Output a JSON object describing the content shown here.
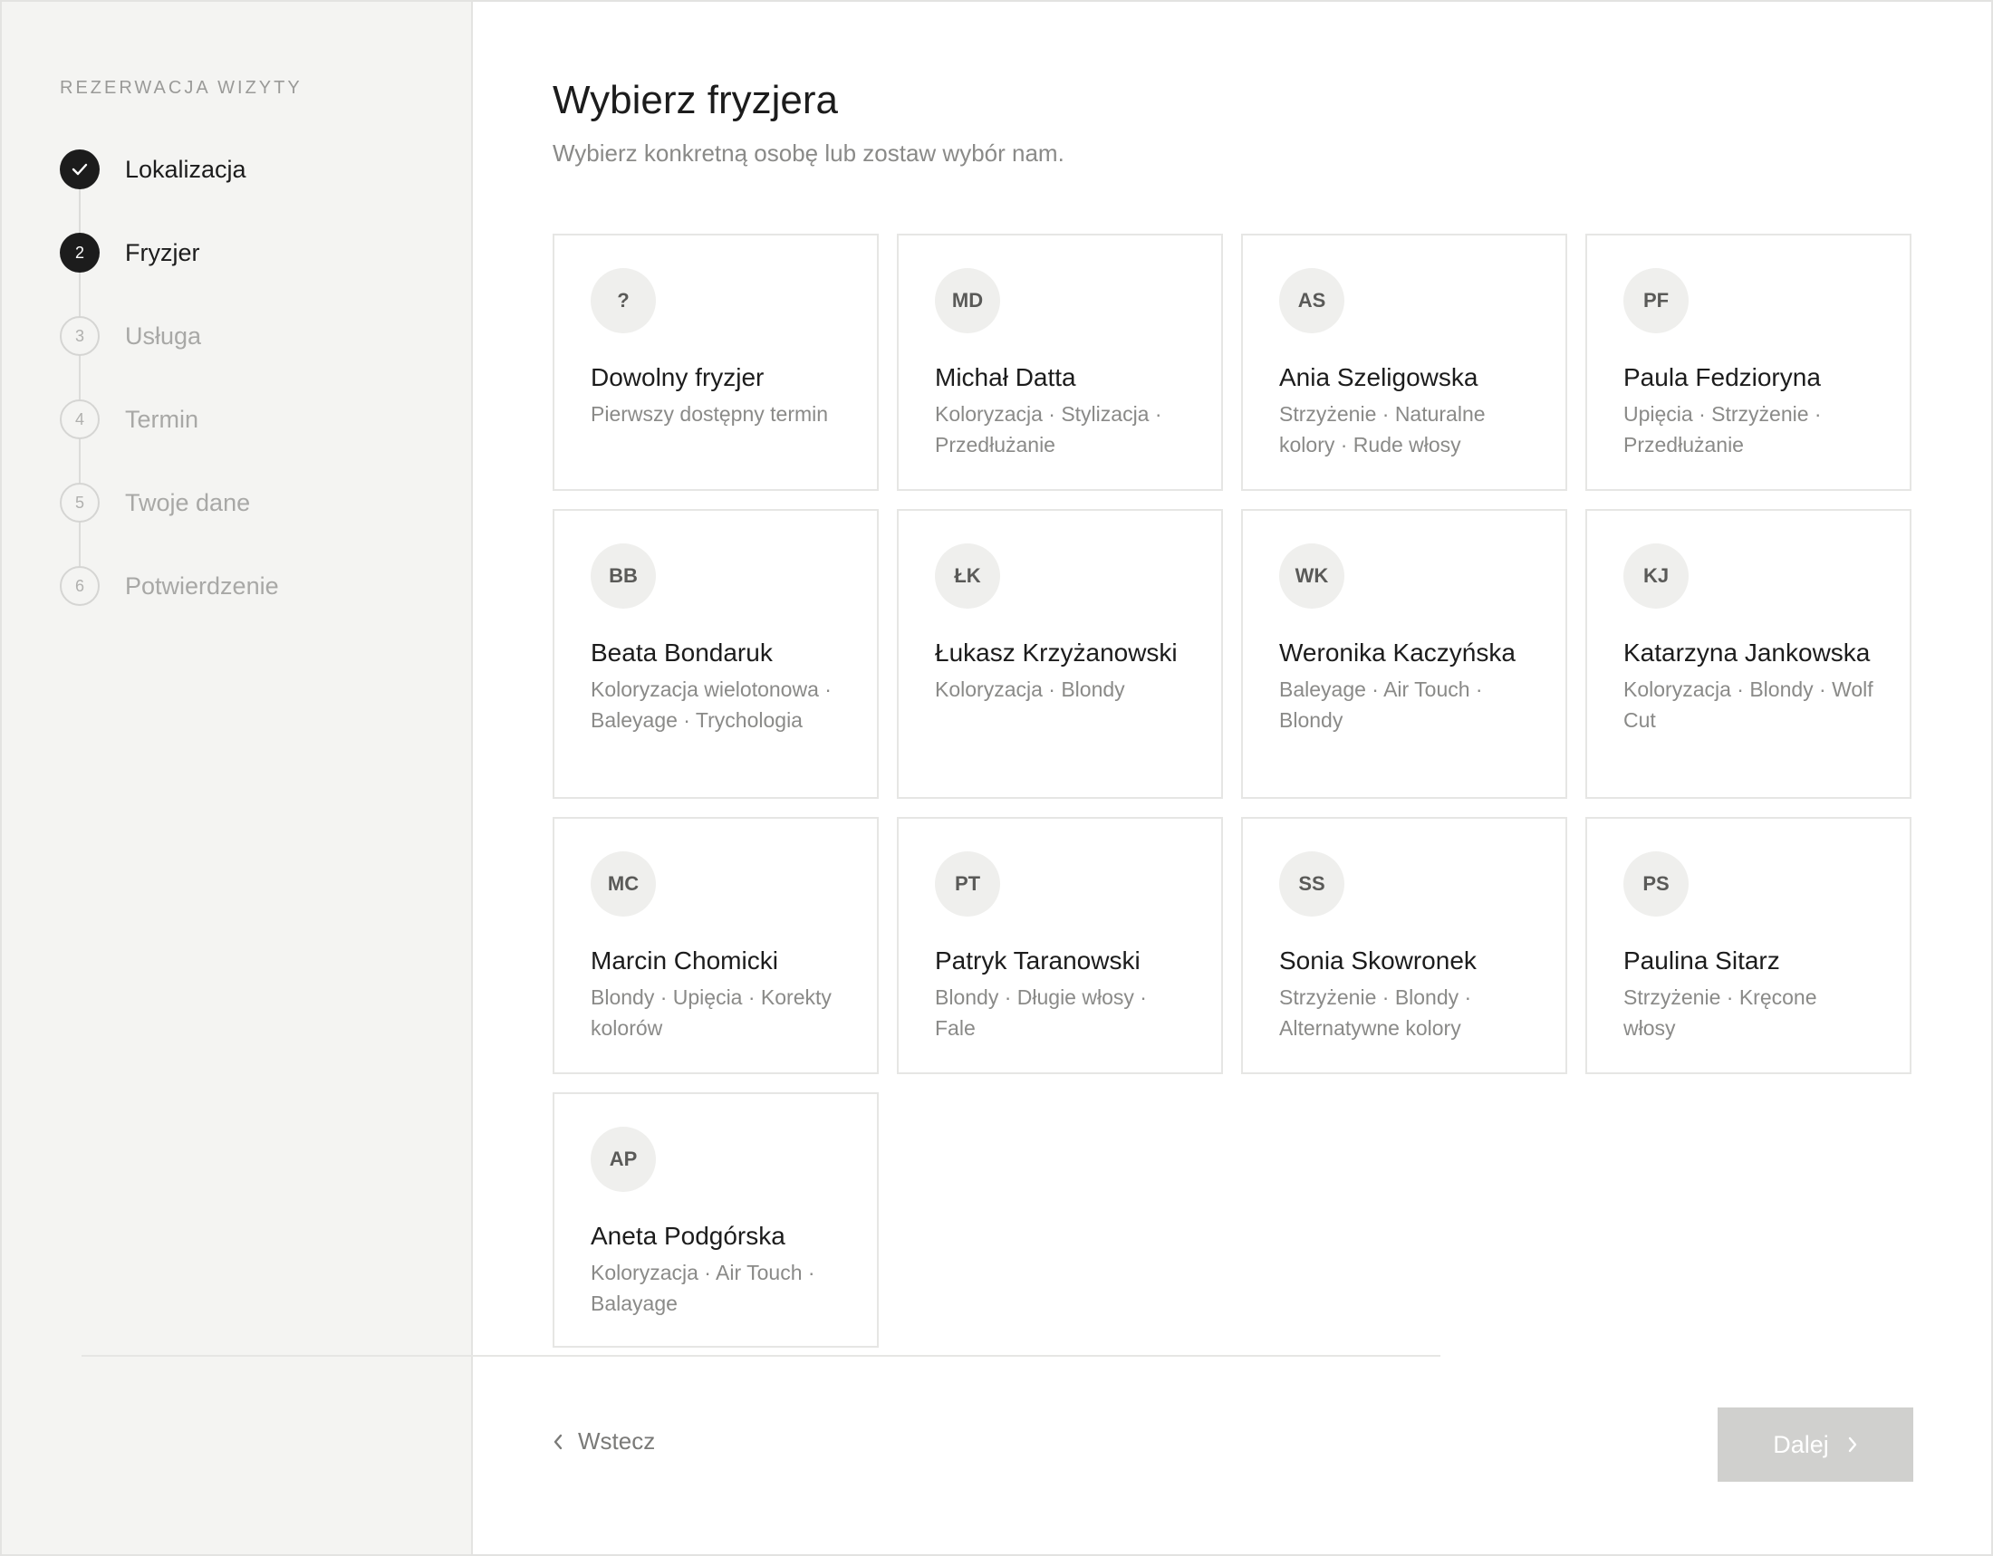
{
  "sidebar": {
    "heading": "REZERWACJA WIZYTY",
    "steps": [
      {
        "number": "",
        "label": "Lokalizacja",
        "state": "done",
        "icon": "check-icon"
      },
      {
        "number": "2",
        "label": "Fryzjer",
        "state": "active"
      },
      {
        "number": "3",
        "label": "Usługa",
        "state": "pending"
      },
      {
        "number": "4",
        "label": "Termin",
        "state": "pending"
      },
      {
        "number": "5",
        "label": "Twoje dane",
        "state": "pending"
      },
      {
        "number": "6",
        "label": "Potwierdzenie",
        "state": "pending"
      }
    ]
  },
  "main": {
    "title": "Wybierz fryzjera",
    "subtitle": "Wybierz konkretną osobę lub zostaw wybór nam.",
    "stylists": [
      {
        "initials": "?",
        "name": "Dowolny fryzjer",
        "tags": "Pierwszy dostępny termin"
      },
      {
        "initials": "MD",
        "name": "Michał Datta",
        "tags": "Koloryzacja · Stylizacja · Przedłużanie"
      },
      {
        "initials": "AS",
        "name": "Ania Szeligowska",
        "tags": "Strzyżenie · Naturalne kolory · Rude włosy"
      },
      {
        "initials": "PF",
        "name": "Paula Fedzioryna",
        "tags": "Upięcia · Strzyżenie · Przedłużanie"
      },
      {
        "initials": "BB",
        "name": "Beata Bondaruk",
        "tags": "Koloryzacja wielotonowa · Baleyage · Trychologia"
      },
      {
        "initials": "ŁK",
        "name": "Łukasz Krzyżanowski",
        "tags": "Koloryzacja · Blondy"
      },
      {
        "initials": "WK",
        "name": "Weronika Kaczyńska",
        "tags": "Baleyage · Air Touch · Blondy"
      },
      {
        "initials": "KJ",
        "name": "Katarzyna Jankowska",
        "tags": "Koloryzacja · Blondy · Wolf Cut"
      },
      {
        "initials": "MC",
        "name": "Marcin Chomicki",
        "tags": "Blondy · Upięcia · Korekty kolorów"
      },
      {
        "initials": "PT",
        "name": "Patryk Taranowski",
        "tags": "Blondy · Długie włosy · Fale"
      },
      {
        "initials": "SS",
        "name": "Sonia Skowronek",
        "tags": "Strzyżenie · Blondy · Alternatywne kolory"
      },
      {
        "initials": "PS",
        "name": "Paulina Sitarz",
        "tags": "Strzyżenie · Kręcone włosy"
      },
      {
        "initials": "AP",
        "name": "Aneta Podgórska",
        "tags": "Koloryzacja · Air Touch · Balayage"
      }
    ]
  },
  "footer": {
    "back_label": "Wstecz",
    "back_icon": "chevron-left-icon",
    "next_label": "Dalej",
    "next_icon": "chevron-right-icon"
  },
  "colors": {
    "sidebar_bg": "#f4f4f2",
    "active": "#1c1c1c",
    "muted": "#8a8a88",
    "next_disabled": "#d0d0ce"
  }
}
